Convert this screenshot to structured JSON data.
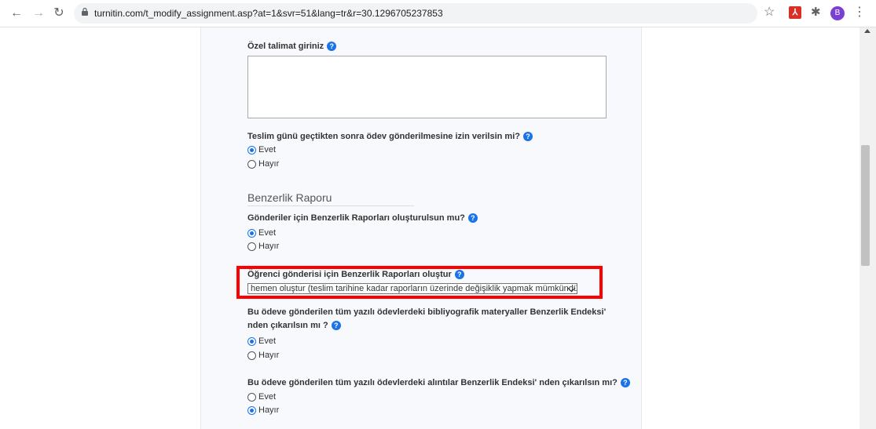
{
  "browser": {
    "url": "turnitin.com/t_modify_assignment.asp?at=1&svr=51&lang=tr&r=30.1296705237853",
    "profile_initial": "B"
  },
  "form": {
    "special_instructions_label": "Özel talimat giriniz",
    "late_submission_label": "Teslim günü geçtikten sonra ödev gönderilmesine izin verilsin mi?",
    "late_submission_options": [
      "Evet",
      "Hayır"
    ],
    "late_submission_selected": "Evet",
    "section_title": "Benzerlik Raporu",
    "generate_reports_label": "Gönderiler için Benzerlik Raporları oluşturulsun mu?",
    "generate_reports_options": [
      "Evet",
      "Hayır"
    ],
    "generate_reports_selected": "Evet",
    "student_report_label": "Öğrenci gönderisi için Benzerlik Raporları oluştur",
    "student_report_select_value": "hemen oluştur (teslim tarihine kadar raporların üzerinde değişiklik yapmak mümkündür)",
    "exclude_bibliography_label": "Bu ödeve gönderilen tüm yazılı ödevlerdeki bibliyografik materyaller Benzerlik Endeksi' nden çıkarılsın mı ?",
    "exclude_bibliography_options": [
      "Evet",
      "Hayır"
    ],
    "exclude_bibliography_selected": "Evet",
    "exclude_quotes_label": "Bu ödeve gönderilen tüm yazılı ödevlerdeki alıntılar Benzerlik Endeksi' nden çıkarılsın mı?",
    "exclude_quotes_options": [
      "Evet",
      "Hayır"
    ],
    "exclude_quotes_selected": "Hayır"
  },
  "colors": {
    "accent": "#1a73e8",
    "highlight": "#ff0000"
  }
}
